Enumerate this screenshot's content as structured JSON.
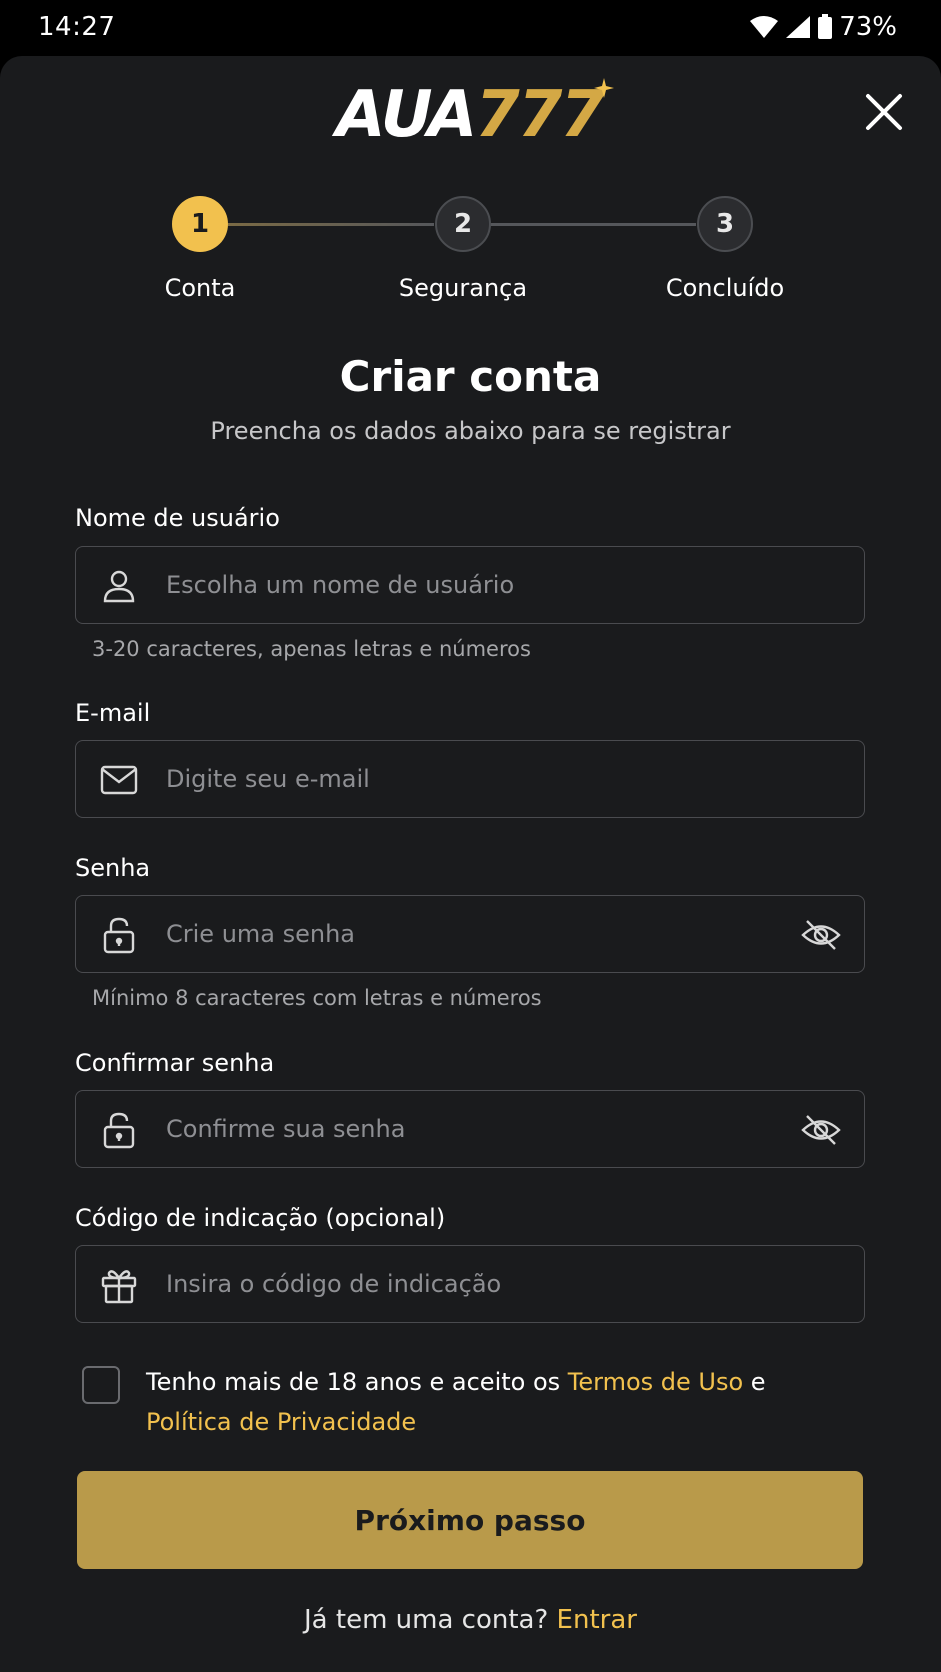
{
  "status_bar": {
    "time": "14:27",
    "battery": "73%"
  },
  "logo": {
    "part1": "AUA",
    "part2": "777"
  },
  "colors": {
    "accent": "#f2c14e",
    "button": "#b99a4a",
    "background": "#1a1b1d"
  },
  "stepper": {
    "steps": [
      {
        "number": "1",
        "label": "Conta",
        "state": "active"
      },
      {
        "number": "2",
        "label": "Segurança",
        "state": "inactive"
      },
      {
        "number": "3",
        "label": "Concluído",
        "state": "inactive"
      }
    ]
  },
  "header": {
    "title": "Criar conta",
    "subtitle": "Preencha os dados abaixo para se registrar"
  },
  "form": {
    "username": {
      "label": "Nome de usuário",
      "placeholder": "Escolha um nome de usuário",
      "value": "",
      "hint": "3-20 caracteres, apenas letras e números",
      "icon": "user-icon"
    },
    "email": {
      "label": "E-mail",
      "placeholder": "Digite seu e-mail",
      "value": "",
      "icon": "mail-icon"
    },
    "password": {
      "label": "Senha",
      "placeholder": "Crie uma senha",
      "value": "",
      "hint": "Mínimo 8 caracteres com letras e números",
      "icon": "lock-icon"
    },
    "confirm_password": {
      "label": "Confirmar senha",
      "placeholder": "Confirme sua senha",
      "value": "",
      "icon": "lock-icon"
    },
    "referral": {
      "label": "Código de indicação (opcional)",
      "placeholder": "Insira o código de indicação",
      "value": "",
      "icon": "gift-icon"
    },
    "terms": {
      "prefix": "Tenho mais de 18 anos e aceito os ",
      "terms_link": "Termos de Uso",
      "connector": " e ",
      "privacy_link": "Política de Privacidade",
      "checked": false
    },
    "submit_label": "Próximo passo"
  },
  "footer": {
    "question": "Já tem uma conta? ",
    "login_link": "Entrar"
  }
}
